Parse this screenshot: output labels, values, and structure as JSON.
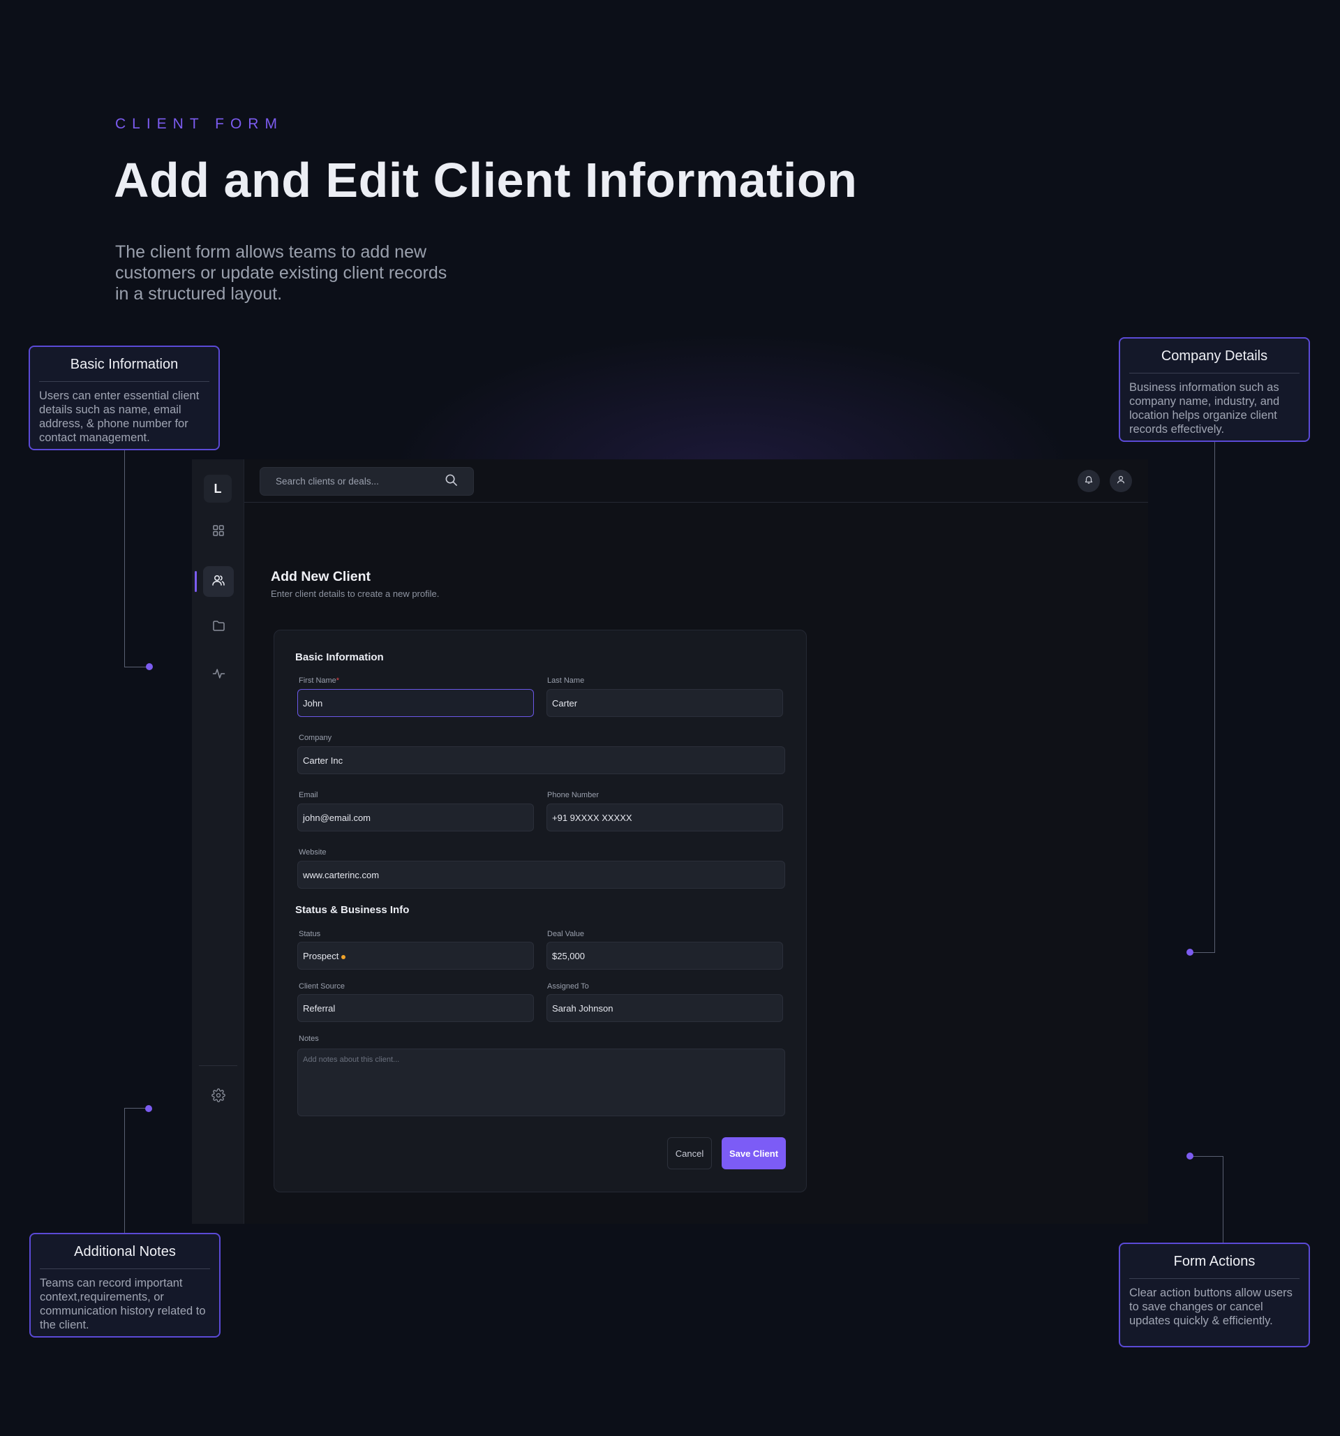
{
  "header": {
    "eyebrow": "CLIENT FORM",
    "title": "Add and Edit Client Information",
    "description": "The client form allows teams to add new customers or update existing client records in a structured layout."
  },
  "callouts": {
    "basic": {
      "title": "Basic Information",
      "text": "Users can enter essential client details such as name, email address, & phone number for contact management."
    },
    "company": {
      "title": "Company Details",
      "text": "Business information such as company name, industry, and location helps organize client records effectively."
    },
    "notes": {
      "title": "Additional Notes",
      "text": "Teams can record important context,requirements, or communication history related to the client."
    },
    "actions": {
      "title": "Form Actions",
      "text": "Clear action buttons allow users to save changes or cancel updates quickly & efficiently."
    }
  },
  "sidebar": {
    "logo": "L",
    "items": [
      {
        "icon": "grid-icon"
      },
      {
        "icon": "users-icon",
        "active": true
      },
      {
        "icon": "folder-icon"
      },
      {
        "icon": "activity-icon"
      }
    ],
    "footer_icon": "gear-icon"
  },
  "topbar": {
    "search_placeholder": "Search clients or deals...",
    "icons": [
      "bell-icon",
      "user-icon"
    ]
  },
  "form": {
    "title": "Add New Client",
    "subtitle": "Enter client details to create a new profile.",
    "sections": {
      "basic": "Basic Information",
      "status": "Status & Business Info"
    },
    "fields": {
      "first_name": {
        "label": "First Name",
        "required_mark": "*",
        "value": "John"
      },
      "last_name": {
        "label": "Last Name",
        "value": "Carter"
      },
      "company": {
        "label": "Company",
        "value": "Carter Inc"
      },
      "email": {
        "label": "Email",
        "value": "john@email.com"
      },
      "phone": {
        "label": "Phone Number",
        "value": "+91 9XXXX XXXXX"
      },
      "website": {
        "label": "Website",
        "value": "www.carterinc.com"
      },
      "status": {
        "label": "Status",
        "value": "Prospect",
        "dot_color": "#f0a32a"
      },
      "deal_value": {
        "label": "Deal Value",
        "value": "$25,000"
      },
      "client_source": {
        "label": "Client Source",
        "value": "Referral"
      },
      "assigned_to": {
        "label": "Assigned To",
        "value": "Sarah Johnson"
      },
      "notes": {
        "label": "Notes",
        "placeholder": "Add notes about this client..."
      }
    },
    "buttons": {
      "cancel": "Cancel",
      "save": "Save Client"
    }
  },
  "colors": {
    "accent": "#7c5cf0",
    "background": "#0c0f18",
    "status_prospect": "#f0a32a"
  }
}
